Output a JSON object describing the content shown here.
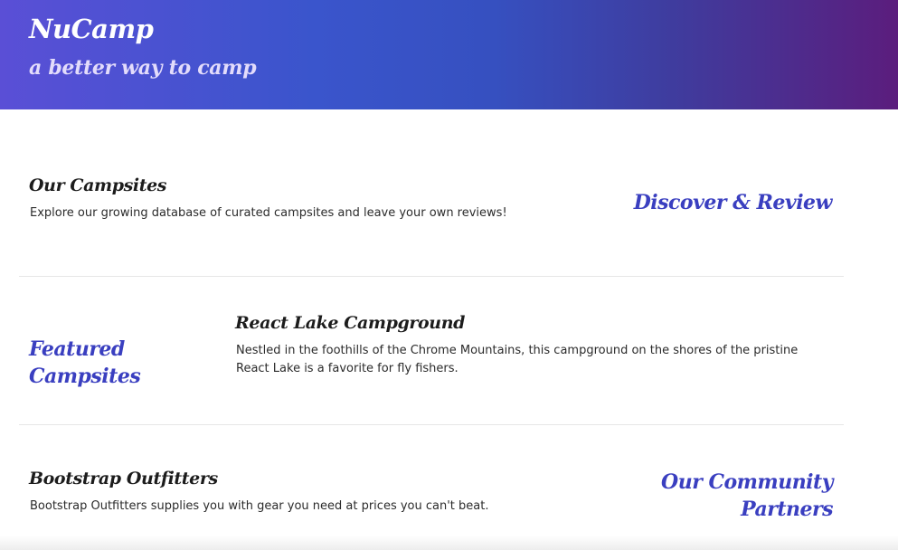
{
  "header": {
    "brand": "NuCamp",
    "tagline": "a better way to camp",
    "gradient_colors": [
      "#5a4fd6",
      "#3650c0",
      "#5b1d7d"
    ]
  },
  "sections": {
    "campsites": {
      "title": "Our Campsites",
      "text": "Explore our growing database of curated campsites and leave your own reviews!",
      "accent": "Discover & Review"
    },
    "featured": {
      "accent": "Featured Campsites",
      "title": "React Lake Campground",
      "text": "Nestled in the foothills of the Chrome Mountains, this campground on the shores of the pristine React Lake is a favorite for fly fishers."
    },
    "partners": {
      "title": "Bootstrap Outfitters",
      "text": "Bootstrap Outfitters supplies you with gear you need at prices you can't beat.",
      "accent": "Our Community Partners"
    }
  },
  "colors": {
    "accent": "#3a3fc0",
    "title": "#1c1c1c",
    "divider": "#e6e6e6"
  }
}
